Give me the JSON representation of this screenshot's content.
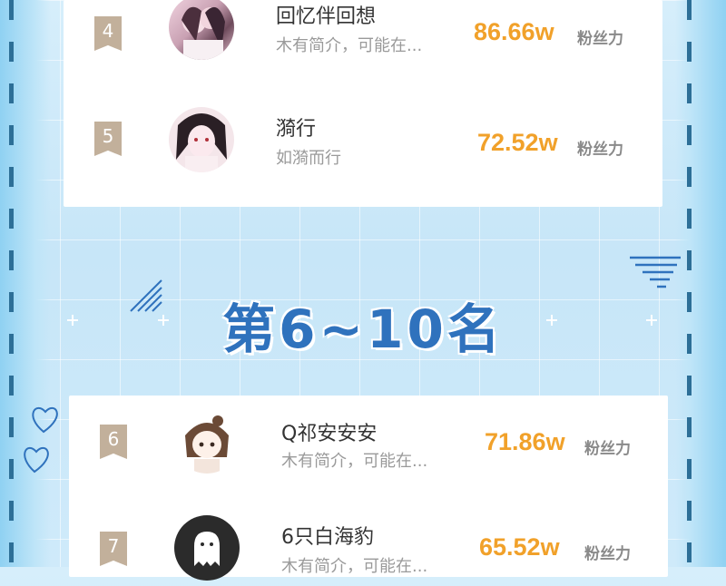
{
  "section_title": "第6~10名",
  "fans_label": "粉丝力",
  "accent_color": "#f1a12a",
  "title_color": "#2f72bd",
  "entries": [
    {
      "rank": "4",
      "name": "回忆伴回想",
      "bio": "木有简介，可能在...",
      "fans": "86.66w",
      "avatar": "couple-illustration"
    },
    {
      "rank": "5",
      "name": "漪行",
      "bio": "如漪而行",
      "fans": "72.52w",
      "avatar": "dark-haired-girl-illustration"
    },
    {
      "rank": "6",
      "name": "Q祁安安安",
      "bio": "木有简介，可能在...",
      "fans": "71.86w",
      "avatar": "chibi-girl-illustration"
    },
    {
      "rank": "7",
      "name": "6只白海豹",
      "bio": "木有简介，可能在...",
      "fans": "65.52w",
      "avatar": "default-ghost-avatar"
    }
  ]
}
